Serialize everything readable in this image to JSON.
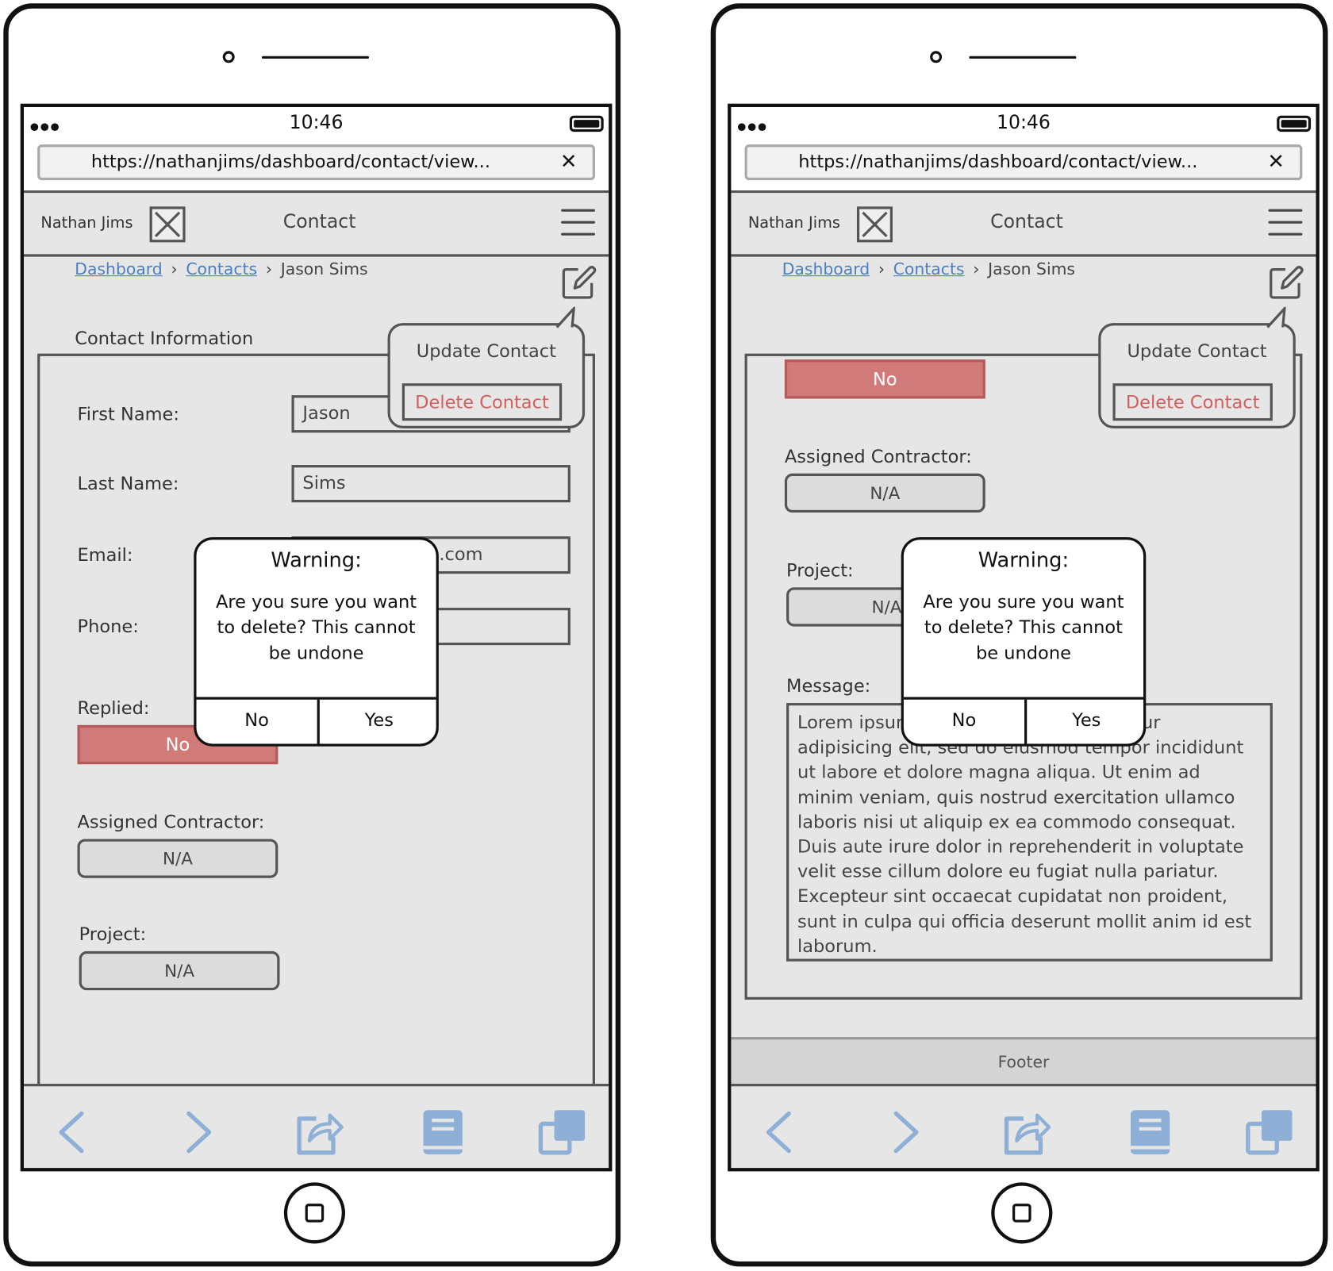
{
  "phones": [
    {
      "status": {
        "time": "10:46"
      },
      "url": "https://nathanjims/dashboard/contact/view...",
      "header": {
        "brand": "Nathan Jims",
        "title": "Contact"
      },
      "breadcrumb": {
        "items": [
          "Dashboard",
          "Contacts",
          "Jason Sims"
        ]
      },
      "section_label": "Contact Information",
      "fields": {
        "first_name": {
          "label": "First Name:",
          "value": "Jason"
        },
        "last_name": {
          "label": "Last Name:",
          "value": "Sims"
        },
        "email": {
          "label": "Email:",
          "value": ".com"
        },
        "phone": {
          "label": "Phone:",
          "value": ""
        }
      },
      "replied": {
        "label": "Replied:",
        "value": "No"
      },
      "assigned_contractor": {
        "label": "Assigned Contractor:",
        "value": "N/A"
      },
      "project": {
        "label": "Project:",
        "value": "N/A"
      },
      "popover": {
        "update": "Update Contact",
        "delete": "Delete Contact"
      },
      "modal": {
        "title": "Warning:",
        "message": "Are you sure you want to delete? This cannot be undone",
        "no": "No",
        "yes": "Yes"
      }
    },
    {
      "status": {
        "time": "10:46"
      },
      "url": "https://nathanjims/dashboard/contact/view...",
      "header": {
        "brand": "Nathan Jims",
        "title": "Contact"
      },
      "breadcrumb": {
        "items": [
          "Dashboard",
          "Contacts",
          "Jason Sims"
        ]
      },
      "replied": {
        "value": "No"
      },
      "assigned_contractor": {
        "label": "Assigned Contractor:",
        "value": "N/A"
      },
      "project": {
        "label": "Project:",
        "value": "N/A"
      },
      "message": {
        "label": "Message:",
        "lines": [
          "Lorem ipsum dolor sit amet, consectetur",
          "adipisicing elit, sed do eiusmod tempor incididunt",
          "ut labore et dolore magna aliqua. Ut enim ad",
          "minim veniam, quis nostrud exercitation ullamco",
          "laboris nisi ut aliquip ex ea commodo consequat.",
          "Duis aute irure dolor in reprehenderit in voluptate",
          "velit esse cillum dolore eu fugiat nulla pariatur.",
          "Excepteur sint occaecat cupidatat non proident,",
          "sunt in culpa qui officia deserunt mollit anim id est",
          "laborum."
        ]
      },
      "footer": "Footer",
      "popover": {
        "update": "Update Contact",
        "delete": "Delete Contact"
      },
      "modal": {
        "title": "Warning:",
        "message": "Are you sure you want to delete? This cannot be undone",
        "no": "No",
        "yes": "Yes"
      }
    }
  ],
  "toolbar_icons": [
    "back-icon",
    "forward-icon",
    "share-icon",
    "bookmarks-icon",
    "tabs-icon"
  ],
  "colors": {
    "link": "#4a7fc0",
    "danger": "#d06060",
    "danger_fill": "#d17a7a",
    "toolbar_icon": "#8fb0d6",
    "screen_bg": "#e6e6e6"
  }
}
